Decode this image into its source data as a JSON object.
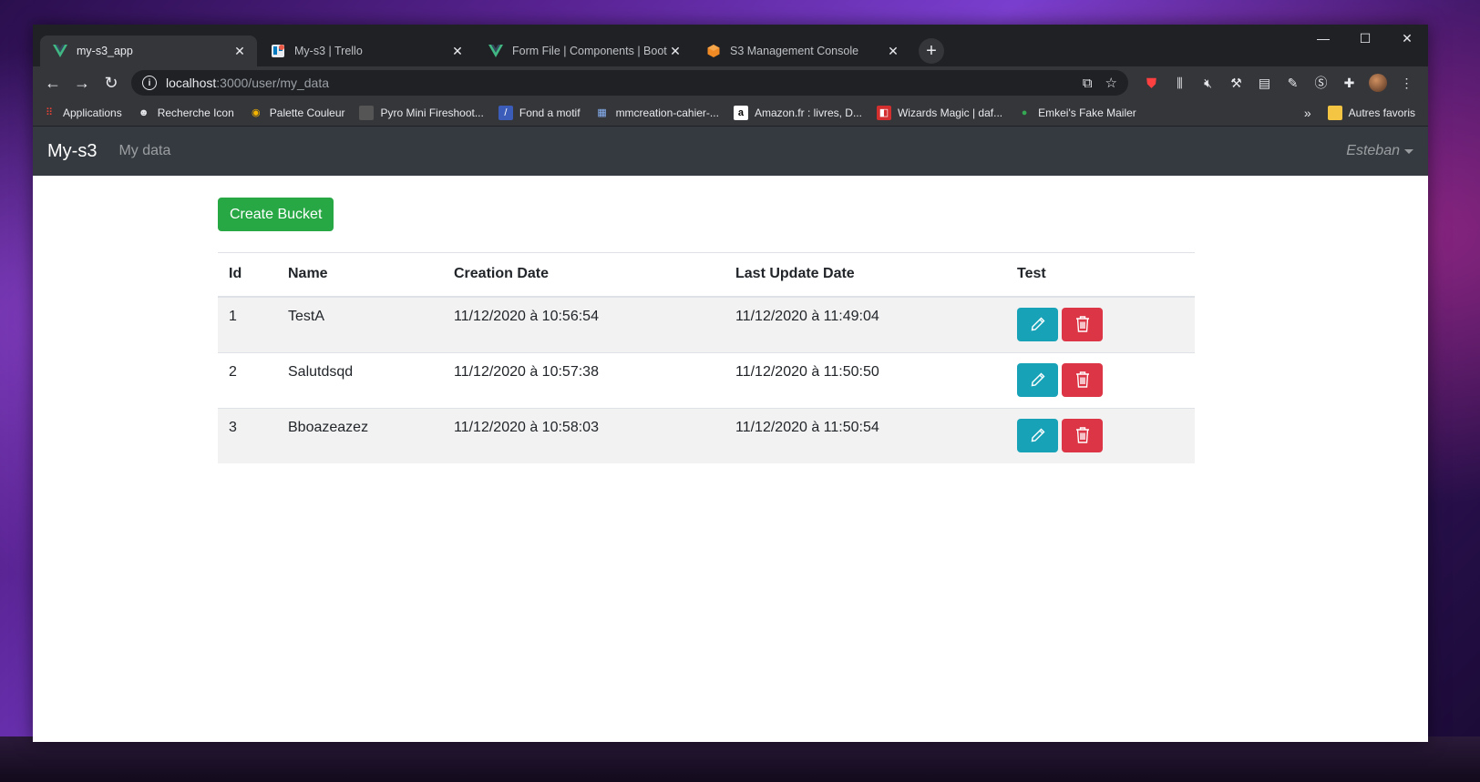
{
  "browser": {
    "tabs": [
      {
        "title": "my-s3_app",
        "icon": "vue-icon",
        "active": true
      },
      {
        "title": "My-s3 | Trello",
        "icon": "trello-icon",
        "active": false
      },
      {
        "title": "Form File | Components | Bootstr",
        "icon": "vue-icon",
        "active": false
      },
      {
        "title": "S3 Management Console",
        "icon": "aws-icon",
        "active": false
      }
    ],
    "url_host": "localhost",
    "url_path": ":3000/user/my_data",
    "bookmarks": [
      {
        "label": "Applications",
        "icon": "apps-grid-icon",
        "color": "#ea4335"
      },
      {
        "label": "Recherche Icon",
        "icon": "panda-icon",
        "color": "#e8eaed"
      },
      {
        "label": "Palette Couleur",
        "icon": "palette-icon",
        "color": "#f4b400"
      },
      {
        "label": "Pyro Mini Fireshoot...",
        "icon": "bookmark-dark-icon",
        "color": "#555"
      },
      {
        "label": "Fond a motif",
        "icon": "pattern-icon",
        "color": "#3b5cb8"
      },
      {
        "label": "mmcreation-cahier-...",
        "icon": "building-icon",
        "color": "#8ab4f8"
      },
      {
        "label": "Amazon.fr : livres, D...",
        "icon": "amazon-icon",
        "color": "#ffffff"
      },
      {
        "label": "Wizards Magic | daf...",
        "icon": "wizards-icon",
        "color": "#d32f2f"
      },
      {
        "label": "Emkei's Fake Mailer",
        "icon": "mailer-icon",
        "color": "#34a853"
      }
    ],
    "other_bookmarks": "Autres favoris"
  },
  "app": {
    "brand": "My-s3",
    "nav_link": "My data",
    "user": "Esteban",
    "create_button": "Create Bucket",
    "columns": [
      "Id",
      "Name",
      "Creation Date",
      "Last Update Date",
      "Test"
    ],
    "rows": [
      {
        "id": "1",
        "name": "TestA",
        "created": "11/12/2020 à 10:56:54",
        "updated": "11/12/2020 à 11:49:04"
      },
      {
        "id": "2",
        "name": "Salutdsqd",
        "created": "11/12/2020 à 10:57:38",
        "updated": "11/12/2020 à 11:50:50"
      },
      {
        "id": "3",
        "name": "Bboazeazez",
        "created": "11/12/2020 à 10:58:03",
        "updated": "11/12/2020 à 11:50:54"
      }
    ]
  },
  "colors": {
    "success": "#28a745",
    "info": "#17a2b8",
    "danger": "#dc3545",
    "navbar": "#343a40"
  }
}
